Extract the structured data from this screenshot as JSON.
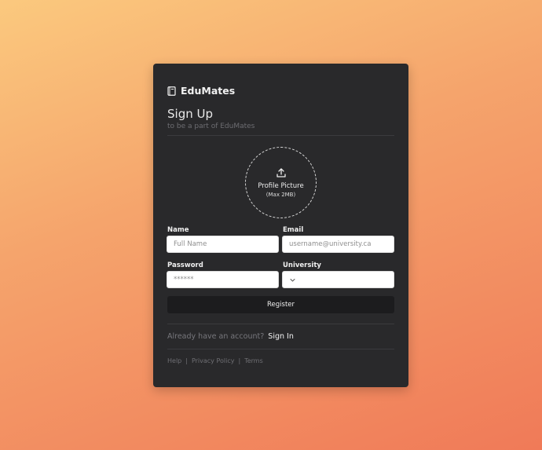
{
  "brand": {
    "name": "EduMates",
    "icon": "book-icon"
  },
  "form": {
    "title": "Sign Up",
    "subtitle": "to be a part of EduMates",
    "upload": {
      "label": "Profile Picture",
      "hint": "(Max 2MB)",
      "icon": "upload-icon"
    },
    "name": {
      "label": "Name",
      "placeholder": "Full Name"
    },
    "email": {
      "label": "Email",
      "placeholder": "username@university.ca"
    },
    "password": {
      "label": "Password",
      "placeholder": "******"
    },
    "university": {
      "label": "University",
      "value": "",
      "icon": "chevron-down-icon"
    },
    "submit_label": "Register"
  },
  "account": {
    "prompt": "Already have an account?",
    "link": "Sign In"
  },
  "footer": {
    "help": "Help",
    "sep1": "|",
    "privacy": "Privacy Policy",
    "sep2": "|",
    "terms": "Terms"
  },
  "colors": {
    "card": "#29292b",
    "button": "#1c1c1e",
    "gradient_top": "#fbc97e",
    "gradient_bottom": "#f07a58"
  }
}
